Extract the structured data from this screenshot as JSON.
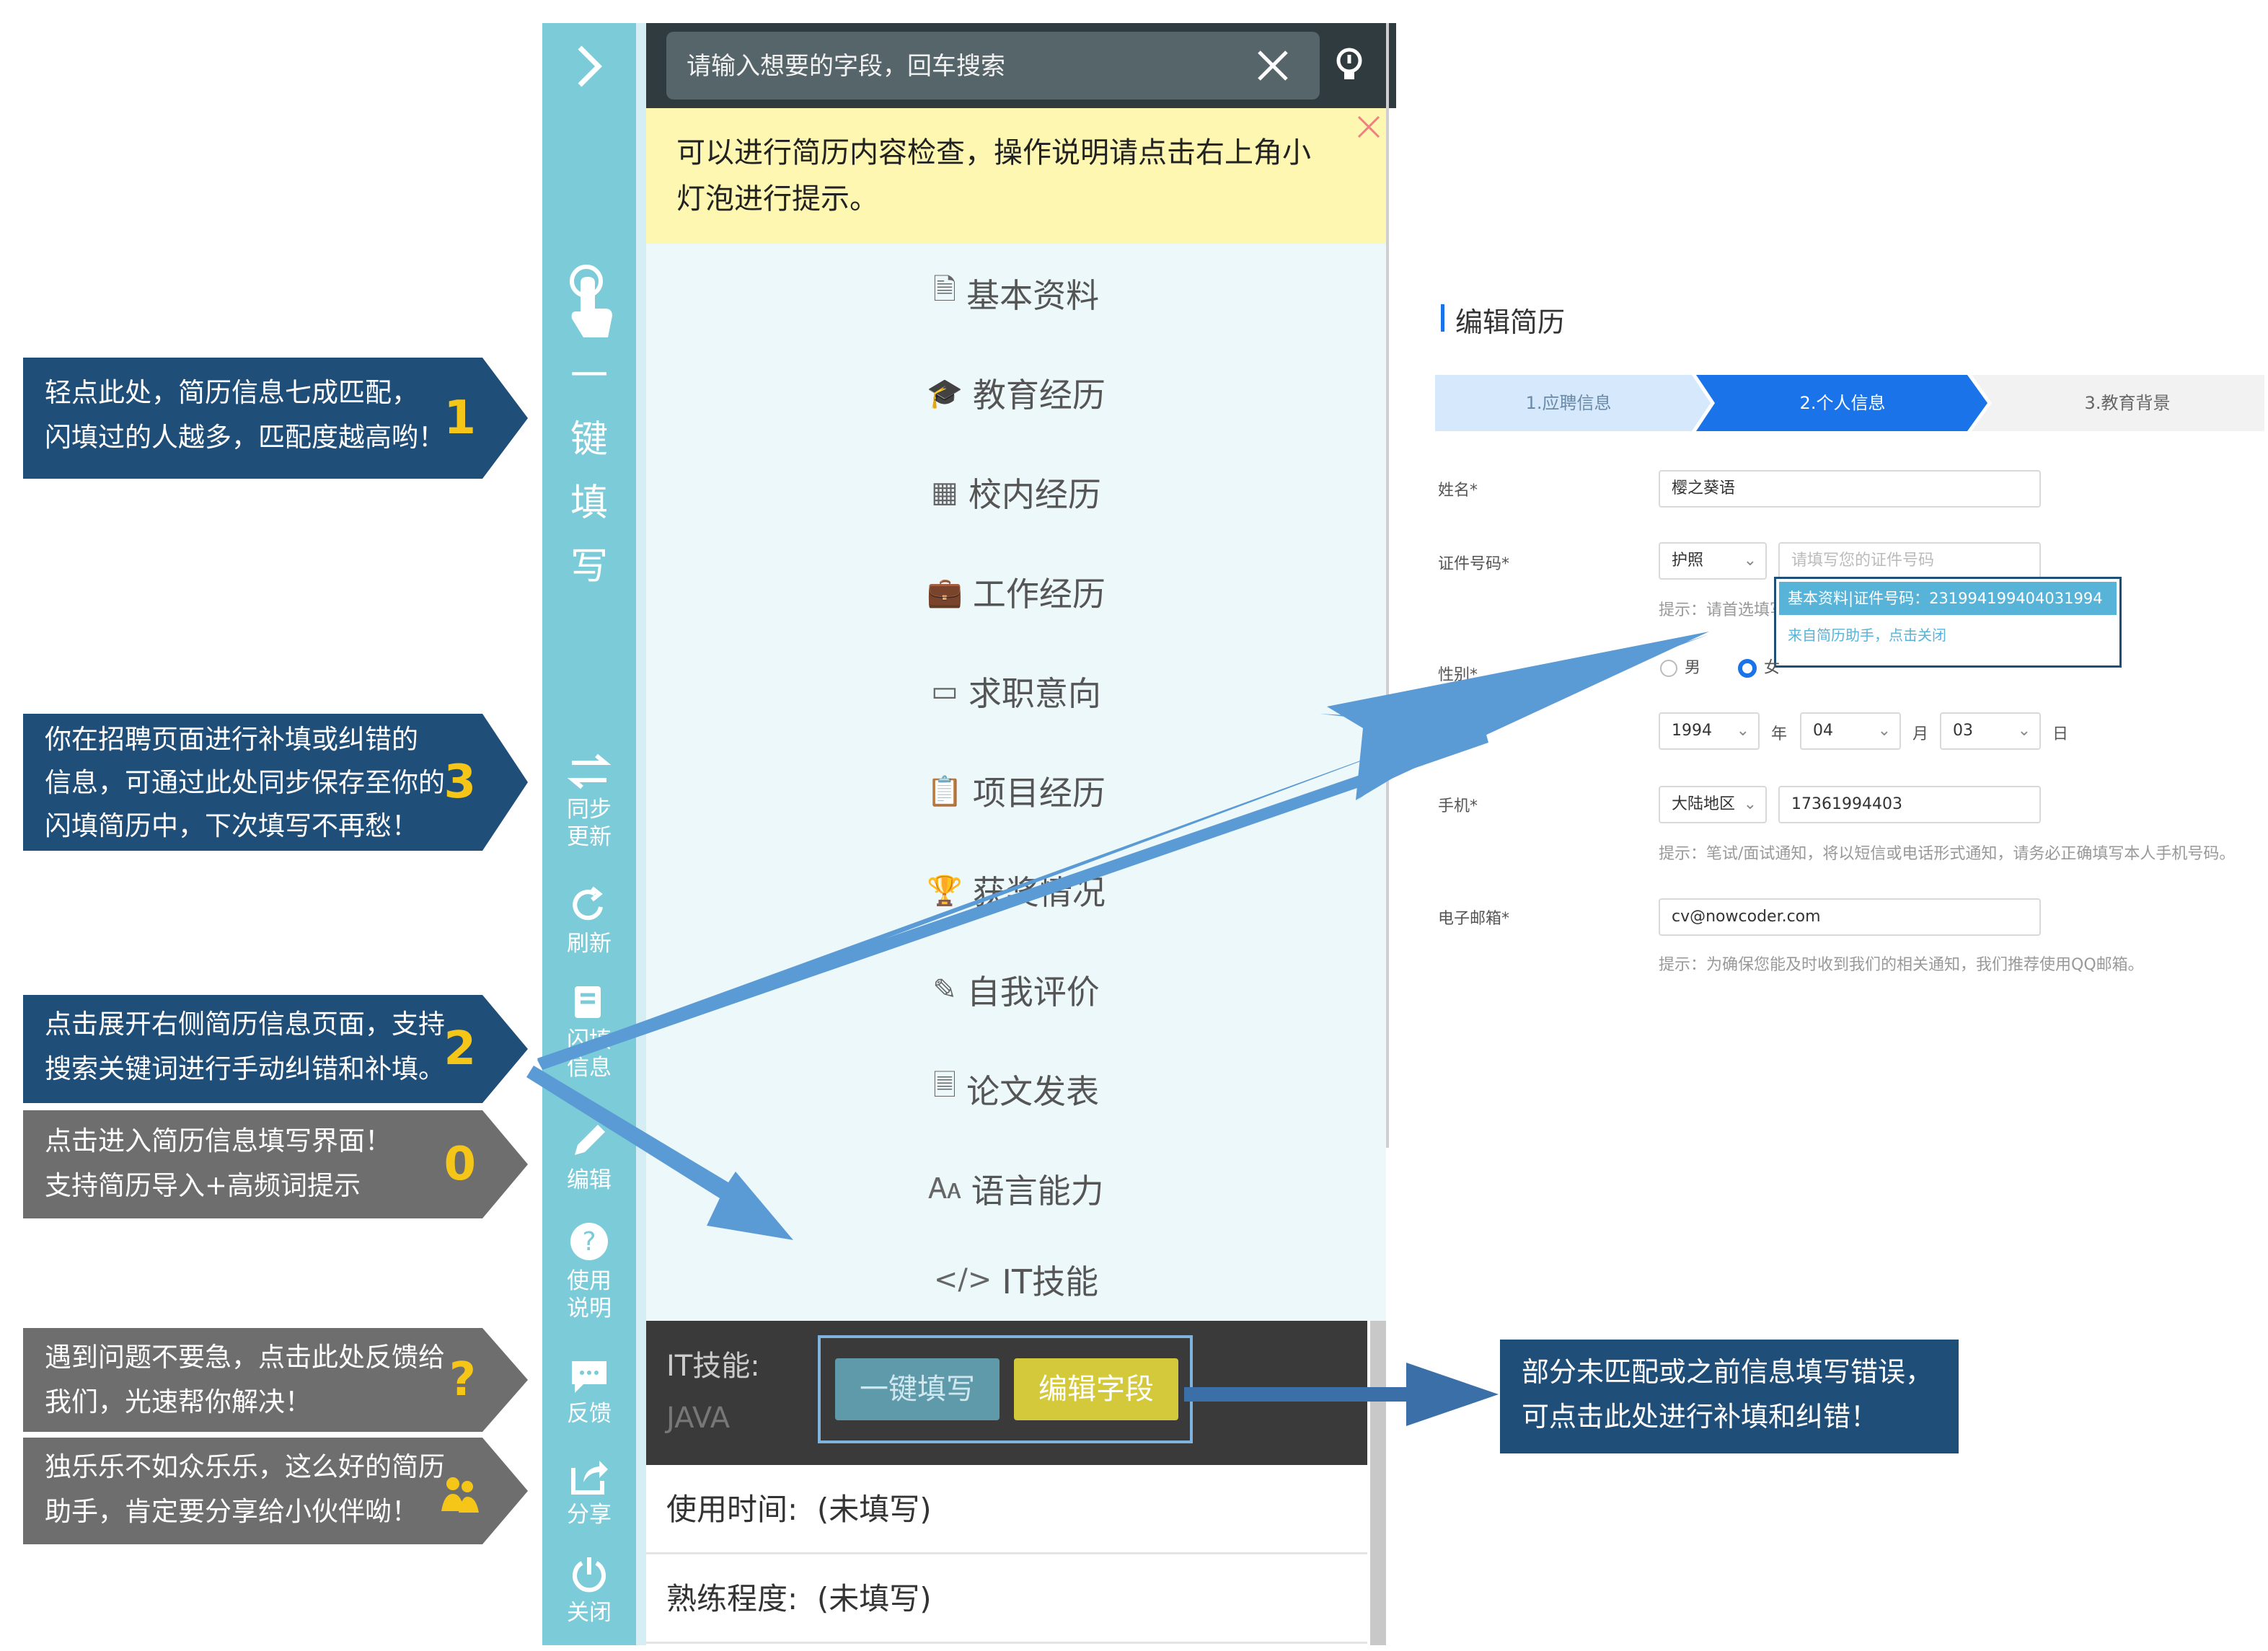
{
  "callouts": [
    {
      "lines": [
        "轻点此处，简历信息七成匹配，",
        "闪填过的人越多，匹配度越高哟！"
      ],
      "num": "1"
    },
    {
      "lines": [
        "你在招聘页面进行补填或纠错的",
        "信息，可通过此处同步保存至你的",
        "闪填简历中，下次填写不再愁！"
      ],
      "num": "3"
    },
    {
      "lines": [
        "点击展开右侧简历信息页面，支持",
        "搜索关键词进行手动纠错和补填。"
      ],
      "num": "2"
    },
    {
      "lines": [
        "点击进入简历信息填写界面！",
        "支持简历导入+高频词提示"
      ],
      "num": "0"
    },
    {
      "lines": [
        "遇到问题不要急，点击此处反馈给",
        "我们，光速帮你解决！"
      ],
      "num": "?"
    },
    {
      "lines": [
        "独乐乐不如众乐乐，这么好的简历",
        "助手，肯定要分享给小伙伴呦！"
      ],
      "num": ""
    }
  ],
  "sidebar": {
    "expand_icon": "chevron-right-icon",
    "onekey": [
      "一",
      "键",
      "填",
      "写"
    ],
    "sync": [
      "同步",
      "更新"
    ],
    "refresh": "刷新",
    "flashinfo": [
      "闪填",
      "信息"
    ],
    "edit": "编辑",
    "help": [
      "使用",
      "说明"
    ],
    "feedback": "反馈",
    "share": "分享",
    "close": "关闭"
  },
  "search": {
    "placeholder": "请输入想要的字段，回车搜索"
  },
  "notice": "可以进行简历内容检查，操作说明请点击右上角小灯泡进行提示。",
  "menu": [
    {
      "label": "基本资料",
      "icon": "document-icon"
    },
    {
      "label": "教育经历",
      "icon": "graduation-cap-icon"
    },
    {
      "label": "校内经历",
      "icon": "building-icon"
    },
    {
      "label": "工作经历",
      "icon": "briefcase-icon"
    },
    {
      "label": "求职意向",
      "icon": "id-card-icon"
    },
    {
      "label": "项目经历",
      "icon": "clipboard-icon"
    },
    {
      "label": "获奖情况",
      "icon": "trophy-icon"
    },
    {
      "label": "自我评价",
      "icon": "pencil-square-icon"
    },
    {
      "label": "论文发表",
      "icon": "paper-icon"
    },
    {
      "label": "语言能力",
      "icon": "language-icon"
    },
    {
      "label": "IT技能",
      "icon": "code-icon"
    }
  ],
  "it_skill": {
    "label": "IT技能:",
    "value": "JAVA",
    "btn_fill": "一键填写",
    "btn_edit": "编辑字段"
  },
  "rows": [
    {
      "label": "使用时间:",
      "value": "(未填写)"
    },
    {
      "label": "熟练程度:",
      "value": "(未填写)"
    }
  ],
  "resume": {
    "title": "编辑简历",
    "steps": [
      "1.应聘信息",
      "2.个人信息",
      "3.教育背景"
    ],
    "name_label": "姓名*",
    "name_value": "樱之葵语",
    "id_label": "证件号码*",
    "id_type": "护照",
    "id_placeholder": "请填写您的证件号码",
    "id_hint": "提示：请首选填写",
    "suggest_main": "基本资料|证件号码：231994199404031994",
    "suggest_sub": "来自简历助手，点击关闭",
    "gender_label": "性别*",
    "gender_male": "男",
    "gender_female": "女",
    "birth_year": "1994",
    "birth_year_unit": "年",
    "birth_month": "04",
    "birth_month_unit": "月",
    "birth_day": "03",
    "birth_day_unit": "日",
    "phone_label": "手机*",
    "phone_region": "大陆地区",
    "phone_value": "17361994403",
    "phone_hint": "提示：笔试/面试通知，将以短信或电话形式通知，请务必正确填写本人手机号码。",
    "email_label": "电子邮箱*",
    "email_value": "cv@nowcoder.com",
    "email_hint": "提示：为确保您能及时收到我们的相关通知，我们推荐使用QQ邮箱。"
  },
  "right_callout": [
    "部分未匹配或之前信息填写错误，",
    "可点击此处进行补填和纠错！"
  ],
  "colors": {
    "accent": "#7ccbd9",
    "callout_blue": "#1f4e79",
    "step_blue": "#1a73e8",
    "arrow": "#5b9bd5",
    "button_yellow": "#d4c83b"
  }
}
